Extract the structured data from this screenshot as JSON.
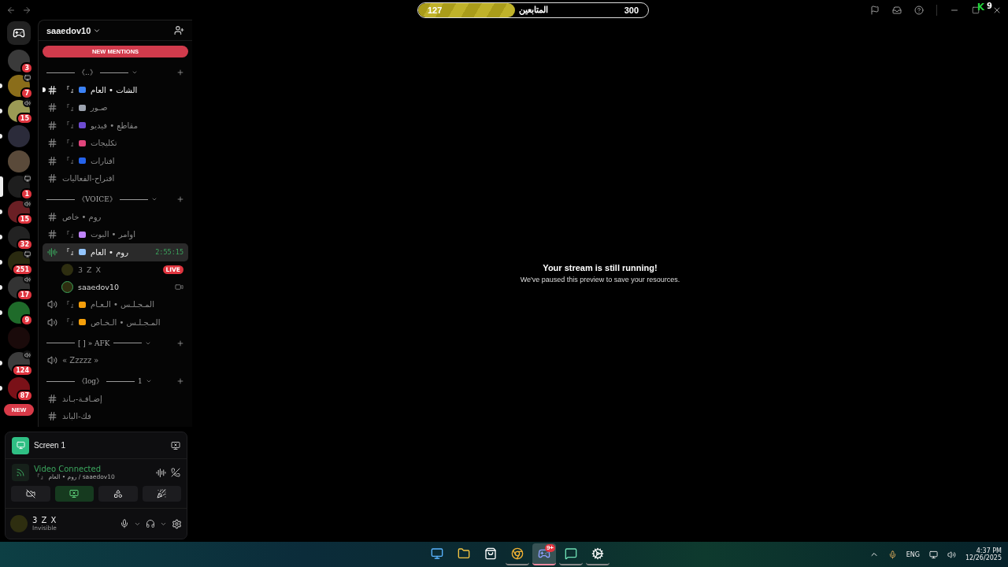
{
  "follower_bar": {
    "current": "127",
    "label": "المتابعين",
    "goal": "300",
    "level": 0.42
  },
  "overlay_badge": {
    "letter": "K",
    "count": "9"
  },
  "servers": [
    {
      "badge": "3",
      "unread": false,
      "kind": "plain",
      "color": "#3a3a3a",
      "selected": false
    },
    {
      "badge": "7",
      "unread": true,
      "kind": "screen",
      "color": "#8a6d1a",
      "selected": false
    },
    {
      "badge": "15",
      "unread": true,
      "kind": "voice",
      "color": "#9b9a55",
      "selected": false
    },
    {
      "unread": true,
      "kind": "plain",
      "color": "#2b2b3a",
      "selected": false
    },
    {
      "unread": false,
      "kind": "plain",
      "color": "#5a4a3a",
      "selected": false
    },
    {
      "badge": "1",
      "unread": false,
      "kind": "screen",
      "color": "#1e1e1e",
      "selected": true
    },
    {
      "badge": "15",
      "unread": true,
      "kind": "voice",
      "color": "#6a1f24",
      "selected": false
    },
    {
      "badge": "32",
      "unread": true,
      "kind": "plain",
      "color": "#222222",
      "selected": false
    },
    {
      "badge": "251",
      "unread": true,
      "kind": "screen",
      "color": "#2a2a10",
      "selected": false
    },
    {
      "badge": "17",
      "unread": true,
      "kind": "voice",
      "color": "#333333",
      "selected": false
    },
    {
      "badge": "9",
      "unread": true,
      "kind": "plain",
      "color": "#1f6b2a",
      "selected": false
    },
    {
      "unread": false,
      "kind": "plain",
      "color": "#1a0a0a",
      "selected": false
    },
    {
      "badge": "124",
      "unread": true,
      "kind": "voice",
      "color": "#3c3c3c",
      "selected": false
    },
    {
      "badge": "87",
      "unread": true,
      "kind": "plain",
      "color": "#7a1118",
      "selected": false
    }
  ],
  "new_pill": "NEW",
  "server_name": "saaedov10",
  "new_mentions": "NEW MENTIONS",
  "categories": [
    {
      "name": "《..》",
      "channels": [
        {
          "kind": "text",
          "tag": "『』",
          "name": "الشات • العام",
          "unread": true,
          "color": "#3b82f6"
        },
        {
          "kind": "text",
          "tag": "『』",
          "name": "صـور",
          "unread": false,
          "color": "#9ca3af"
        },
        {
          "kind": "text",
          "tag": "『』",
          "name": "مقاطع • فيديو",
          "unread": false,
          "color": "#6d4bd1"
        },
        {
          "kind": "text",
          "tag": "『』",
          "name": "تكليجات",
          "unread": false,
          "color": "#e0457b"
        },
        {
          "kind": "text",
          "tag": "『』",
          "name": "افتارات",
          "unread": false,
          "color": "#2563eb"
        },
        {
          "kind": "text",
          "name": "اقتراح-الفعاليات",
          "unread": false
        }
      ]
    },
    {
      "name": "《VOICE》",
      "channels": [
        {
          "kind": "text",
          "name": "روم • خاص",
          "unread": false
        },
        {
          "kind": "text",
          "tag": "『』",
          "name": "اوامر • البوت",
          "unread": false,
          "color": "#c084fc"
        },
        {
          "kind": "voice",
          "tag": "『』",
          "name": "روم • العام",
          "unread": true,
          "color": "#93c5fd",
          "selected": true,
          "timer": "2:55:15",
          "users": [
            {
              "name": "3 Z X",
              "live": "LIVE"
            },
            {
              "name": "saaedov10",
              "camera": true
            }
          ]
        },
        {
          "kind": "voice",
          "tag": "『』",
          "name": "المـجـلـس • الـعـام",
          "unread": false,
          "color": "#f59e0b",
          "selected": false
        },
        {
          "kind": "voice",
          "tag": "『』",
          "name": "المـجـلـس • الـخـاص",
          "unread": false,
          "color": "#f5a00b",
          "selected": false
        }
      ]
    },
    {
      "name": "[ ] » AFK",
      "channels": [
        {
          "kind": "voice",
          "name": "« Zzzzz »",
          "unread": false,
          "selected": false
        }
      ]
    },
    {
      "name": "《log》",
      "count": "1",
      "channels": [
        {
          "kind": "text",
          "name": "إضـافـة-بـاند",
          "unread": false
        },
        {
          "kind": "text",
          "name": "فك-الباند",
          "unread": false
        }
      ]
    }
  ],
  "stream_panel": {
    "title": "Screen 1",
    "status": "Video Connected",
    "location": "『』 روم • العام / saaedov10",
    "buttons": [
      {
        "kind": "camera",
        "selected": false
      },
      {
        "kind": "screen",
        "selected": true
      },
      {
        "kind": "activities",
        "selected": false
      },
      {
        "kind": "soundboard",
        "selected": false
      }
    ]
  },
  "user": {
    "name": "3 Z X",
    "status": "Invisible"
  },
  "main": {
    "title": "Your stream is still running!",
    "subtitle": "We've paused this preview to save your resources."
  },
  "taskbar": {
    "apps": [
      {
        "kind": "start",
        "running": false,
        "selected": false
      },
      {
        "kind": "folder",
        "running": false,
        "selected": false
      },
      {
        "kind": "store",
        "running": false,
        "selected": false
      },
      {
        "kind": "chrome",
        "running": true,
        "selected": false
      },
      {
        "kind": "discord",
        "running": true,
        "selected": true,
        "badge": "9+"
      },
      {
        "kind": "app",
        "running": true,
        "selected": false
      },
      {
        "kind": "steam",
        "running": true,
        "selected": false
      }
    ],
    "language": "ENG",
    "time": "4:37 PM",
    "date": "12/26/2025"
  }
}
